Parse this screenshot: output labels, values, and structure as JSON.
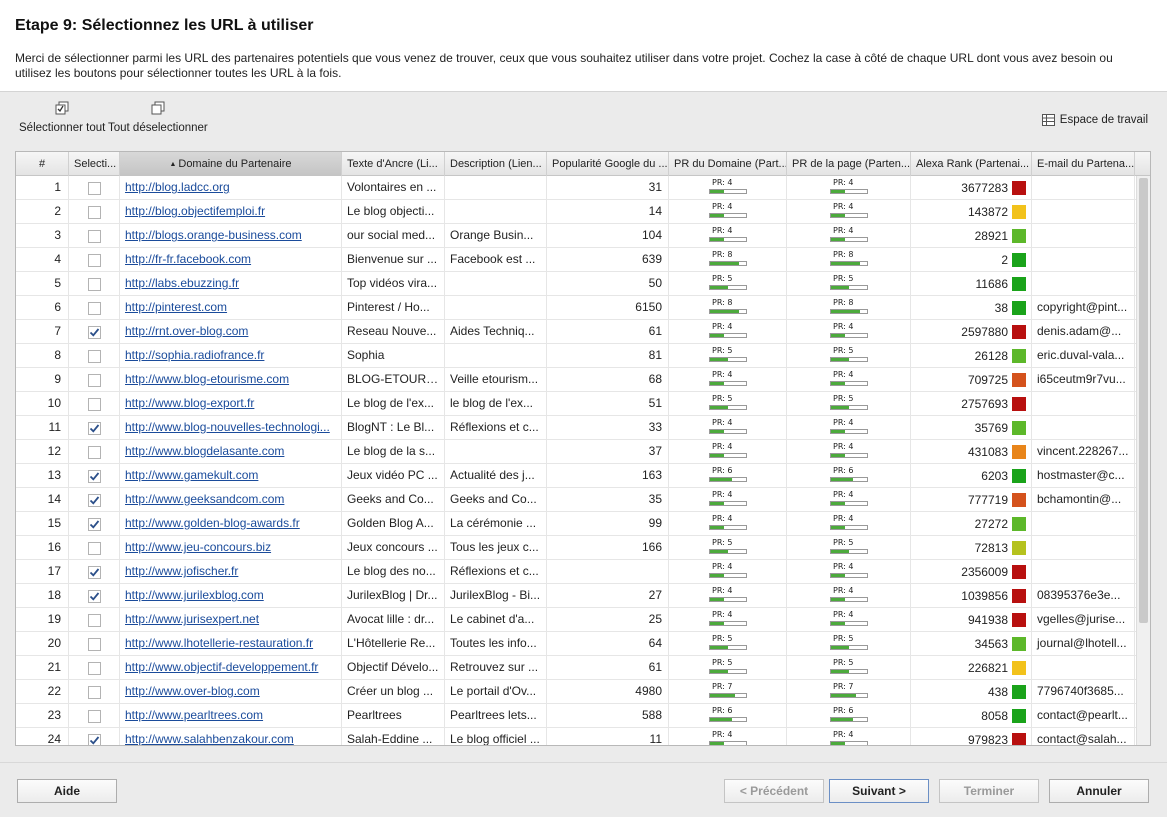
{
  "header": {
    "title": "Etape 9: Sélectionnez les URL à utiliser",
    "description": "Merci de sélectionner parmi les URL des partenaires potentiels que vous venez de trouver, ceux que vous souhaitez utiliser dans votre projet. Cochez la case à côté de chaque URL dont vous avez besoin ou utilisez les boutons pour sélectionner toutes les URL à la fois."
  },
  "toolbar": {
    "select_all": "Sélectionner tout",
    "deselect_all": "Tout déselectionner",
    "workspace": "Espace de travail"
  },
  "columns": [
    "#",
    "Selecti...",
    "Domaine du Partenaire",
    "Texte d'Ancre (Li...",
    "Description (Lien...",
    "Popularité Google du ...",
    "PR du Domaine (Part...",
    "PR de la page (Parten...",
    "Alexa Rank (Partenai...",
    "E-mail du Partena..."
  ],
  "colors": {
    "green": "#1aa31a",
    "lightgreen": "#5db82a",
    "yellow": "#f2c21b",
    "orange": "#e8851a",
    "orangered": "#d4521c",
    "red": "#b8100f",
    "olive": "#b5c21e"
  },
  "rows": [
    {
      "n": "1",
      "checked": false,
      "domain": "http://blog.ladcc.org",
      "anchor": "Volontaires en ...",
      "desc": "",
      "pop": "31",
      "prd": "PR: 4",
      "prd_val": 4,
      "prp": "PR: 4",
      "prp_val": 4,
      "alexa": "3677283",
      "rank_color": "red",
      "email": ""
    },
    {
      "n": "2",
      "checked": false,
      "domain": "http://blog.objectifemploi.fr",
      "anchor": "Le blog objecti...",
      "desc": "",
      "pop": "14",
      "prd": "PR: 4",
      "prd_val": 4,
      "prp": "PR: 4",
      "prp_val": 4,
      "alexa": "143872",
      "rank_color": "yellow",
      "email": ""
    },
    {
      "n": "3",
      "checked": false,
      "domain": "http://blogs.orange-business.com",
      "anchor": "our social med...",
      "desc": "Orange Busin...",
      "pop": "104",
      "prd": "PR: 4",
      "prd_val": 4,
      "prp": "PR: 4",
      "prp_val": 4,
      "alexa": "28921",
      "rank_color": "lightgreen",
      "email": ""
    },
    {
      "n": "4",
      "checked": false,
      "domain": "http://fr-fr.facebook.com",
      "anchor": "Bienvenue sur ...",
      "desc": "Facebook est ...",
      "pop": "639",
      "prd": "PR: 8",
      "prd_val": 8,
      "prp": "PR: 8",
      "prp_val": 8,
      "alexa": "2",
      "rank_color": "green",
      "email": ""
    },
    {
      "n": "5",
      "checked": false,
      "domain": "http://labs.ebuzzing.fr",
      "anchor": "Top vidéos vira...",
      "desc": "",
      "pop": "50",
      "prd": "PR: 5",
      "prd_val": 5,
      "prp": "PR: 5",
      "prp_val": 5,
      "alexa": "11686",
      "rank_color": "green",
      "email": ""
    },
    {
      "n": "6",
      "checked": false,
      "domain": "http://pinterest.com",
      "anchor": "Pinterest / Ho...",
      "desc": "",
      "pop": "6150",
      "prd": "PR: 8",
      "prd_val": 8,
      "prp": "PR: 8",
      "prp_val": 8,
      "alexa": "38",
      "rank_color": "green",
      "email": "copyright@pint..."
    },
    {
      "n": "7",
      "checked": true,
      "domain": "http://rnt.over-blog.com",
      "anchor": "Reseau Nouve...",
      "desc": "Aides Techniq...",
      "pop": "61",
      "prd": "PR: 4",
      "prd_val": 4,
      "prp": "PR: 4",
      "prp_val": 4,
      "alexa": "2597880",
      "rank_color": "red",
      "email": "denis.adam@..."
    },
    {
      "n": "8",
      "checked": false,
      "domain": "http://sophia.radiofrance.fr",
      "anchor": "Sophia",
      "desc": "",
      "pop": "81",
      "prd": "PR: 5",
      "prd_val": 5,
      "prp": "PR: 5",
      "prp_val": 5,
      "alexa": "26128",
      "rank_color": "lightgreen",
      "email": "eric.duval-vala..."
    },
    {
      "n": "9",
      "checked": false,
      "domain": "http://www.blog-etourisme.com",
      "anchor": "BLOG-ETOURI...",
      "desc": "Veille etourism...",
      "pop": "68",
      "prd": "PR: 4",
      "prd_val": 4,
      "prp": "PR: 4",
      "prp_val": 4,
      "alexa": "709725",
      "rank_color": "orangered",
      "email": "i65ceutm9r7vu..."
    },
    {
      "n": "10",
      "checked": false,
      "domain": "http://www.blog-export.fr",
      "anchor": "Le blog de l'ex...",
      "desc": "le blog de l'ex...",
      "pop": "51",
      "prd": "PR: 5",
      "prd_val": 5,
      "prp": "PR: 5",
      "prp_val": 5,
      "alexa": "2757693",
      "rank_color": "red",
      "email": ""
    },
    {
      "n": "11",
      "checked": true,
      "domain": "http://www.blog-nouvelles-technologi...",
      "anchor": "BlogNT : Le Bl...",
      "desc": "Réflexions et c...",
      "pop": "33",
      "prd": "PR: 4",
      "prd_val": 4,
      "prp": "PR: 4",
      "prp_val": 4,
      "alexa": "35769",
      "rank_color": "lightgreen",
      "email": ""
    },
    {
      "n": "12",
      "checked": false,
      "domain": "http://www.blogdelasante.com",
      "anchor": "Le blog de la s...",
      "desc": "",
      "pop": "37",
      "prd": "PR: 4",
      "prd_val": 4,
      "prp": "PR: 4",
      "prp_val": 4,
      "alexa": "431083",
      "rank_color": "orange",
      "email": "vincent.228267..."
    },
    {
      "n": "13",
      "checked": true,
      "domain": "http://www.gamekult.com",
      "anchor": "Jeux vidéo PC ...",
      "desc": "Actualité des j...",
      "pop": "163",
      "prd": "PR: 6",
      "prd_val": 6,
      "prp": "PR: 6",
      "prp_val": 6,
      "alexa": "6203",
      "rank_color": "green",
      "email": "hostmaster@c..."
    },
    {
      "n": "14",
      "checked": true,
      "domain": "http://www.geeksandcom.com",
      "anchor": "Geeks and Co...",
      "desc": "Geeks and Co...",
      "pop": "35",
      "prd": "PR: 4",
      "prd_val": 4,
      "prp": "PR: 4",
      "prp_val": 4,
      "alexa": "777719",
      "rank_color": "orangered",
      "email": "bchamontin@..."
    },
    {
      "n": "15",
      "checked": true,
      "domain": "http://www.golden-blog-awards.fr",
      "anchor": "Golden Blog A...",
      "desc": "La cérémonie ...",
      "pop": "99",
      "prd": "PR: 4",
      "prd_val": 4,
      "prp": "PR: 4",
      "prp_val": 4,
      "alexa": "27272",
      "rank_color": "lightgreen",
      "email": ""
    },
    {
      "n": "16",
      "checked": false,
      "domain": "http://www.jeu-concours.biz",
      "anchor": "Jeux concours ...",
      "desc": "Tous les jeux c...",
      "pop": "166",
      "prd": "PR: 5",
      "prd_val": 5,
      "prp": "PR: 5",
      "prp_val": 5,
      "alexa": "72813",
      "rank_color": "olive",
      "email": ""
    },
    {
      "n": "17",
      "checked": true,
      "domain": "http://www.jofischer.fr",
      "anchor": "Le blog des no...",
      "desc": "Réflexions et c...",
      "pop": "",
      "prd": "PR: 4",
      "prd_val": 4,
      "prp": "PR: 4",
      "prp_val": 4,
      "alexa": "2356009",
      "rank_color": "red",
      "email": ""
    },
    {
      "n": "18",
      "checked": true,
      "domain": "http://www.jurilexblog.com",
      "anchor": "JurilexBlog | Dr...",
      "desc": "JurilexBlog - Bi...",
      "pop": "27",
      "prd": "PR: 4",
      "prd_val": 4,
      "prp": "PR: 4",
      "prp_val": 4,
      "alexa": "1039856",
      "rank_color": "red",
      "email": "08395376e3e..."
    },
    {
      "n": "19",
      "checked": false,
      "domain": "http://www.jurisexpert.net",
      "anchor": "Avocat lille : dr...",
      "desc": "Le cabinet d'a...",
      "pop": "25",
      "prd": "PR: 4",
      "prd_val": 4,
      "prp": "PR: 4",
      "prp_val": 4,
      "alexa": "941938",
      "rank_color": "red",
      "email": "vgelles@jurise..."
    },
    {
      "n": "20",
      "checked": false,
      "domain": "http://www.lhotellerie-restauration.fr",
      "anchor": "L'Hôtellerie Re...",
      "desc": "Toutes les info...",
      "pop": "64",
      "prd": "PR: 5",
      "prd_val": 5,
      "prp": "PR: 5",
      "prp_val": 5,
      "alexa": "34563",
      "rank_color": "lightgreen",
      "email": "journal@lhotell..."
    },
    {
      "n": "21",
      "checked": false,
      "domain": "http://www.objectif-developpement.fr",
      "anchor": "Objectif Dévelo...",
      "desc": "Retrouvez sur ...",
      "pop": "61",
      "prd": "PR: 5",
      "prd_val": 5,
      "prp": "PR: 5",
      "prp_val": 5,
      "alexa": "226821",
      "rank_color": "yellow",
      "email": ""
    },
    {
      "n": "22",
      "checked": false,
      "domain": "http://www.over-blog.com",
      "anchor": "Créer un blog ...",
      "desc": "Le portail d'Ov...",
      "pop": "4980",
      "prd": "PR: 7",
      "prd_val": 7,
      "prp": "PR: 7",
      "prp_val": 7,
      "alexa": "438",
      "rank_color": "green",
      "email": "7796740f3685..."
    },
    {
      "n": "23",
      "checked": false,
      "domain": "http://www.pearltrees.com",
      "anchor": "Pearltrees",
      "desc": "Pearltrees lets...",
      "pop": "588",
      "prd": "PR: 6",
      "prd_val": 6,
      "prp": "PR: 6",
      "prp_val": 6,
      "alexa": "8058",
      "rank_color": "green",
      "email": "contact@pearlt..."
    },
    {
      "n": "24",
      "checked": true,
      "domain": "http://www.salahbenzakour.com",
      "anchor": "Salah-Eddine ...",
      "desc": "Le blog officiel ...",
      "pop": "11",
      "prd": "PR: 4",
      "prd_val": 4,
      "prp": "PR: 4",
      "prp_val": 4,
      "alexa": "979823",
      "rank_color": "red",
      "email": "contact@salah..."
    }
  ],
  "footer": {
    "help": "Aide",
    "previous": "< Précédent",
    "next": "Suivant >",
    "finish": "Terminer",
    "cancel": "Annuler"
  }
}
